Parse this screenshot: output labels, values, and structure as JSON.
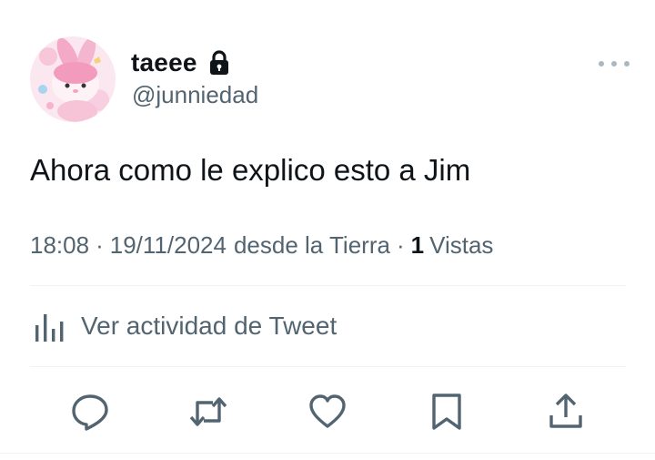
{
  "user": {
    "display_name": "taeee",
    "handle": "@junniedad",
    "avatar_icon": "avatar-image",
    "protected_icon": "lock-icon"
  },
  "tweet": {
    "text": "Ahora como le explico esto a Jim",
    "time": "18:08",
    "date": "19/11/2024",
    "source": "desde la Tierra",
    "separator": "·",
    "views_count": "1",
    "views_label": "Vistas"
  },
  "activity": {
    "label": "Ver actividad de Tweet",
    "icon": "analytics-icon"
  },
  "actions": [
    {
      "name": "reply",
      "icon": "reply-icon"
    },
    {
      "name": "retweet",
      "icon": "retweet-icon"
    },
    {
      "name": "like",
      "icon": "heart-icon"
    },
    {
      "name": "bookmark",
      "icon": "bookmark-icon"
    },
    {
      "name": "share",
      "icon": "share-icon"
    }
  ],
  "colors": {
    "text_primary": "#0f1419",
    "text_secondary": "#536471",
    "divider": "#eff3f4",
    "more_dots": "#aab8c2"
  }
}
